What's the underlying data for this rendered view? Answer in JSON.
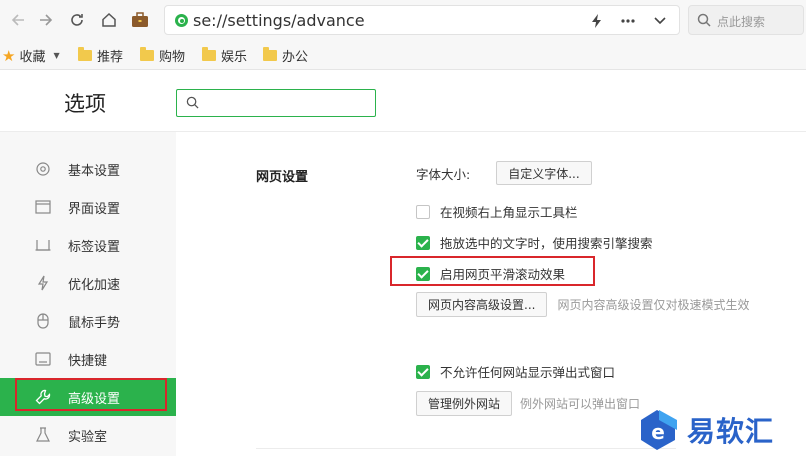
{
  "browser": {
    "url": "se://settings/advance",
    "search_placeholder": "点此搜索",
    "bookmarks": {
      "favorites": "收藏",
      "folders": [
        "推荐",
        "购物",
        "娱乐",
        "办公"
      ]
    }
  },
  "settings": {
    "title": "选项",
    "search_value": "",
    "sidebar": {
      "items": [
        {
          "label": "基本设置",
          "icon": "gear-icon"
        },
        {
          "label": "界面设置",
          "icon": "window-icon"
        },
        {
          "label": "标签设置",
          "icon": "tab-icon"
        },
        {
          "label": "优化加速",
          "icon": "lightning-icon"
        },
        {
          "label": "鼠标手势",
          "icon": "mouse-icon"
        },
        {
          "label": "快捷键",
          "icon": "keyboard-icon"
        },
        {
          "label": "高级设置",
          "icon": "wrench-icon"
        },
        {
          "label": "实验室",
          "icon": "flask-icon"
        }
      ],
      "active_index": 6
    },
    "content": {
      "section_title": "网页设置",
      "font_size_label": "字体大小:",
      "custom_font_button": "自定义字体...",
      "options": [
        {
          "label": "在视频右上角显示工具栏",
          "checked": false
        },
        {
          "label": "拖放选中的文字时，使用搜索引擎搜索",
          "checked": true
        },
        {
          "label": "启用网页平滑滚动效果",
          "checked": true
        }
      ],
      "advanced_button": "网页内容高级设置...",
      "advanced_note": "网页内容高级设置仅对极速模式生效",
      "popup_option": {
        "label": "不允许任何网站显示弹出式窗口",
        "checked": true
      },
      "exceptions_button": "管理例外网站",
      "exceptions_note": "例外网站可以弹出窗口"
    }
  },
  "watermark": {
    "text": "易软汇"
  },
  "colors": {
    "accent": "#2bb24c",
    "highlight": "#d9262b",
    "watermark": "#2a63c9"
  }
}
